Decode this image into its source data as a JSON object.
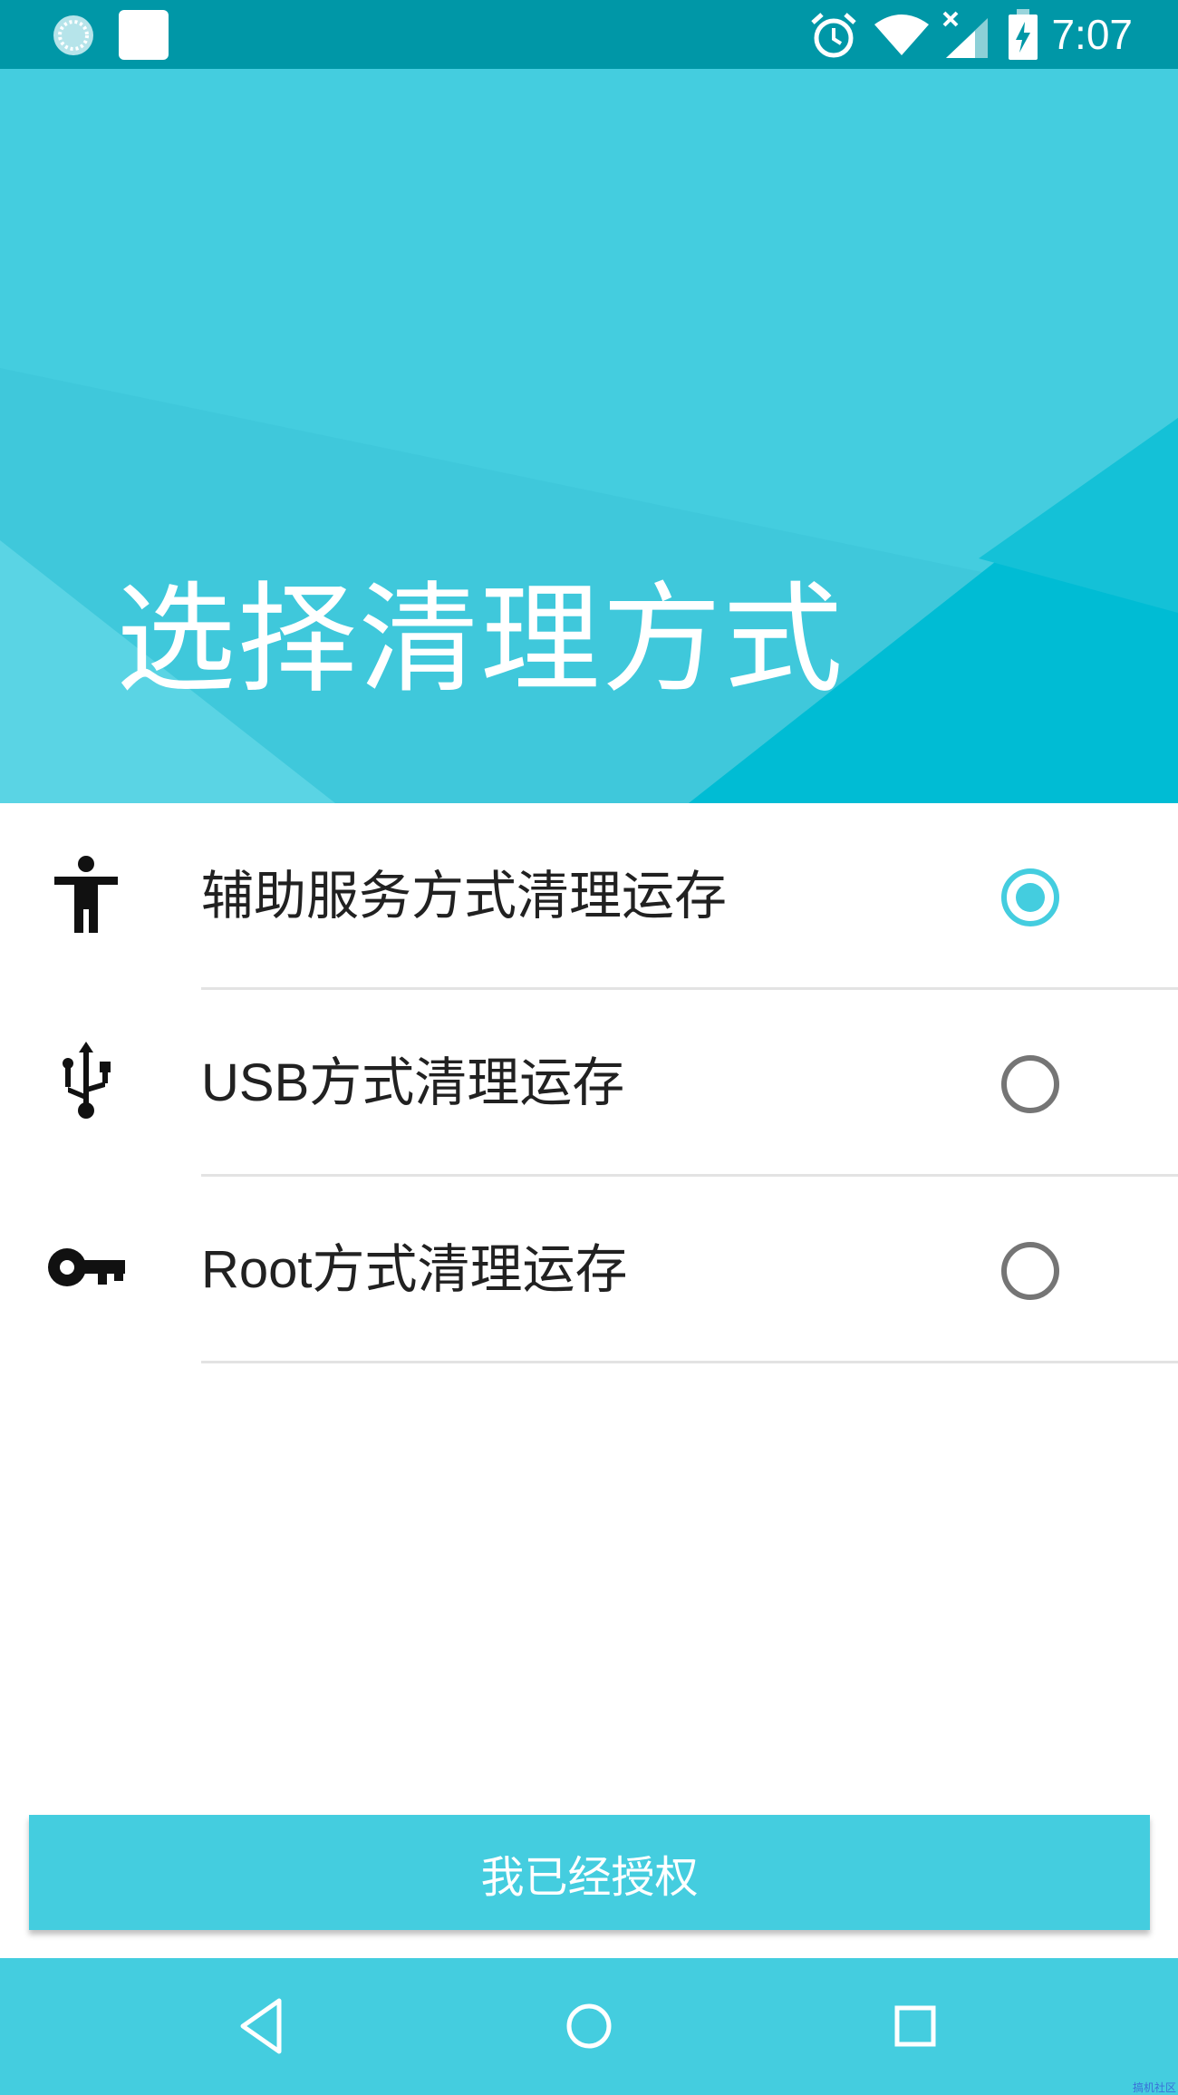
{
  "status_bar": {
    "time": "7:07",
    "icons": [
      "loading-circle-icon",
      "app-square-icon",
      "alarm-icon",
      "wifi-icon",
      "cell-signal-icon",
      "battery-charging-icon"
    ]
  },
  "header": {
    "title": "选择清理方式",
    "background_color": "#44cddf"
  },
  "options": [
    {
      "label": "辅助服务方式清理运存",
      "icon": "accessibility-icon",
      "selected": true
    },
    {
      "label": "USB方式清理运存",
      "icon": "usb-icon",
      "selected": false
    },
    {
      "label": "Root方式清理运存",
      "icon": "key-icon",
      "selected": false
    }
  ],
  "confirm_button": {
    "label": "我已经授权"
  },
  "nav_bar": {
    "icons": [
      "back-icon",
      "home-icon",
      "recents-icon"
    ]
  },
  "watermark": "搞机社区",
  "colors": {
    "accent": "#44cddf",
    "status_bar": "#0097a7",
    "radio_selected": "#44cddf",
    "radio_unselected": "#757575"
  }
}
